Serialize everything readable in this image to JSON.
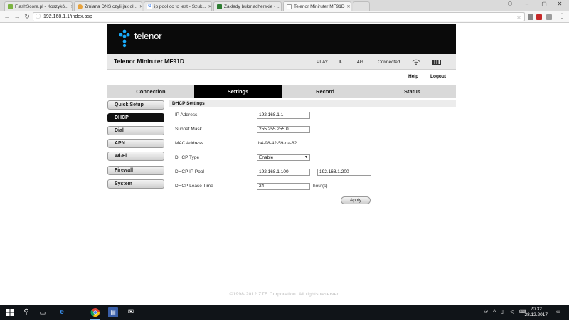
{
  "browser": {
    "tabs": [
      {
        "label": "FlashScore.pl - Koszykó...",
        "favicon_color": "#7cb342",
        "active": false
      },
      {
        "label": "Zmiana DNS czyli jak oł...",
        "favicon_color": "#e8a33d",
        "active": false
      },
      {
        "label": "ip pool co to jest - Szuk...",
        "favicon_color": "#4285f4",
        "active": false
      },
      {
        "label": "Zakłady bukmacherskie - ...",
        "favicon_color": "#2e7d32",
        "active": false
      },
      {
        "label": "Telenor Miniruter MF91D",
        "favicon_color": "#ffffff",
        "active": true
      }
    ],
    "address": "192.168.1.1/index.asp",
    "icons": {
      "back": "back-icon",
      "forward": "forward-icon",
      "reload": "reload-icon",
      "info": "info-icon",
      "bookmark": "star-icon",
      "menu": "menu-icon",
      "user": "user-icon",
      "minimize": "minimize-icon",
      "maximize": "maximize-icon",
      "close": "close-icon"
    }
  },
  "header": {
    "brand": "telenor",
    "model": "Telenor Miniruter MF91D",
    "carrier": "PLAY",
    "network_type": "4G",
    "connection_status": "Connected",
    "icons": {
      "signal": "signal-icon",
      "wifi": "wifi-icon",
      "battery": "battery-icon"
    }
  },
  "top_links": {
    "help": "Help",
    "logout": "Logout"
  },
  "main_nav": [
    {
      "label": "Connection",
      "active": false
    },
    {
      "label": "Settings",
      "active": true
    },
    {
      "label": "Record",
      "active": false
    },
    {
      "label": "Status",
      "active": false
    }
  ],
  "side_nav": [
    {
      "label": "Quick Setup",
      "active": false
    },
    {
      "label": "DHCP",
      "active": true
    },
    {
      "label": "Dial",
      "active": false
    },
    {
      "label": "APN",
      "active": false
    },
    {
      "label": "Wi-Fi",
      "active": false
    },
    {
      "label": "Firewall",
      "active": false
    },
    {
      "label": "System",
      "active": false
    }
  ],
  "dhcp": {
    "title": "DHCP Settings",
    "ip_address_label": "IP Address",
    "ip_address": "192.168.1.1",
    "subnet_mask_label": "Subnet Mask",
    "subnet_mask": "255.255.255.0",
    "mac_label": "MAC Address",
    "mac": "b4-98-42-59-da-82",
    "dhcp_type_label": "DHCP Type",
    "dhcp_type": "Enable",
    "pool_label": "DHCP IP Pool",
    "pool_start": "192.168.1.100",
    "pool_sep": "-",
    "pool_end": "192.168.1.200",
    "lease_label": "DHCP Lease Time",
    "lease": "24",
    "lease_unit": "hour(s)",
    "apply": "Apply"
  },
  "footer": {
    "copyright": "©1998-2012 ZTE Corporation. All rights reserved"
  },
  "taskbar": {
    "time": "20:32",
    "date": "28.12.2017",
    "icons": [
      "windows-start-icon",
      "search-icon",
      "task-view-icon",
      "edge-icon",
      "chrome-icon",
      "app-icon",
      "mail-icon"
    ]
  }
}
